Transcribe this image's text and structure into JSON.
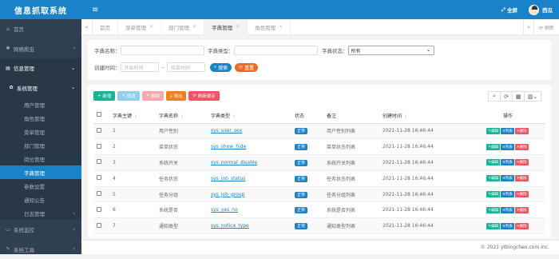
{
  "app": {
    "title": "信息抓取系统"
  },
  "sidebar": {
    "items": [
      {
        "label": "首页",
        "icon": "home-icon"
      },
      {
        "label": "网络爬虫",
        "icon": "bug-icon"
      },
      {
        "label": "信息管理",
        "icon": "newspaper-icon"
      },
      {
        "label": "系统管理",
        "icon": "gear-icon"
      }
    ],
    "sub": [
      "用户管理",
      "角色管理",
      "菜单管理",
      "部门管理",
      "岗位管理",
      "字典管理",
      "参数设置",
      "通知公告",
      "日志管理"
    ],
    "monitor": {
      "label": "系统监控",
      "icon": "monitor-icon"
    },
    "tools": {
      "label": "系统工具",
      "icon": "tools-icon"
    },
    "collapse_arrow": "‹"
  },
  "topbar": {
    "menu_icon": "≡",
    "fullscreen": "全屏",
    "fullscreen_icon": "⤢",
    "user": "西瓜"
  },
  "tabs": {
    "prev": "«",
    "next": "»",
    "refresh": "刷新",
    "items": [
      {
        "label": "首页"
      },
      {
        "label": "菜单管理"
      },
      {
        "label": "部门管理"
      },
      {
        "label": "字典管理"
      },
      {
        "label": "角色管理"
      }
    ]
  },
  "search": {
    "dict_name_label": "字典名称：",
    "dict_type_label": "字典类型：",
    "status_label": "字典状态：",
    "status_value": "所有",
    "created_label": "创建时间：",
    "start_placeholder": "开始时间",
    "end_placeholder": "结束时间",
    "dash": "-",
    "search_btn": "搜索",
    "reset_btn": "重置"
  },
  "toolbar": {
    "add": "新增",
    "edit": "修改",
    "delete": "删除",
    "export": "导出",
    "refresh_cache": "刷新缓存"
  },
  "table": {
    "headers": [
      "字典主键",
      "字典名称",
      "字典类型",
      "状态",
      "备注",
      "创建时间",
      "操作"
    ],
    "rows": [
      {
        "id": "1",
        "name": "用户性别",
        "type": "sys_user_sex",
        "status": "正常",
        "remark": "用户性别列表",
        "time": "2021-11-28 16:46:44"
      },
      {
        "id": "2",
        "name": "菜单状态",
        "type": "sys_show_hide",
        "status": "正常",
        "remark": "菜单状态列表",
        "time": "2021-11-28 16:46:44"
      },
      {
        "id": "3",
        "name": "系统开关",
        "type": "sys_normal_disable",
        "status": "正常",
        "remark": "系统开关列表",
        "time": "2021-11-28 16:46:44"
      },
      {
        "id": "4",
        "name": "任务状态",
        "type": "sys_job_status",
        "status": "正常",
        "remark": "任务状态列表",
        "time": "2021-11-28 16:46:44"
      },
      {
        "id": "5",
        "name": "任务分组",
        "type": "sys_job_group",
        "status": "正常",
        "remark": "任务分组列表",
        "time": "2021-11-28 16:46:44"
      },
      {
        "id": "6",
        "name": "系统是否",
        "type": "sys_yes_no",
        "status": "正常",
        "remark": "系统是否列表",
        "time": "2021-11-28 16:46:44"
      },
      {
        "id": "7",
        "name": "通知类型",
        "type": "sys_notice_type",
        "status": "正常",
        "remark": "通知类型列表",
        "time": "2021-11-28 16:46:44"
      }
    ],
    "actions": {
      "edit": "编辑",
      "list": "列表",
      "delete": "删除"
    }
  },
  "footer": {
    "copyright": "© 2021 ytbingchen.com Inc."
  },
  "colors": {
    "primary": "#1a82c8",
    "sidebar": "#2f4050",
    "green": "#1ab394",
    "blue": "#1c84c6",
    "red": "#ed5565",
    "orange": "#f8ac59"
  }
}
